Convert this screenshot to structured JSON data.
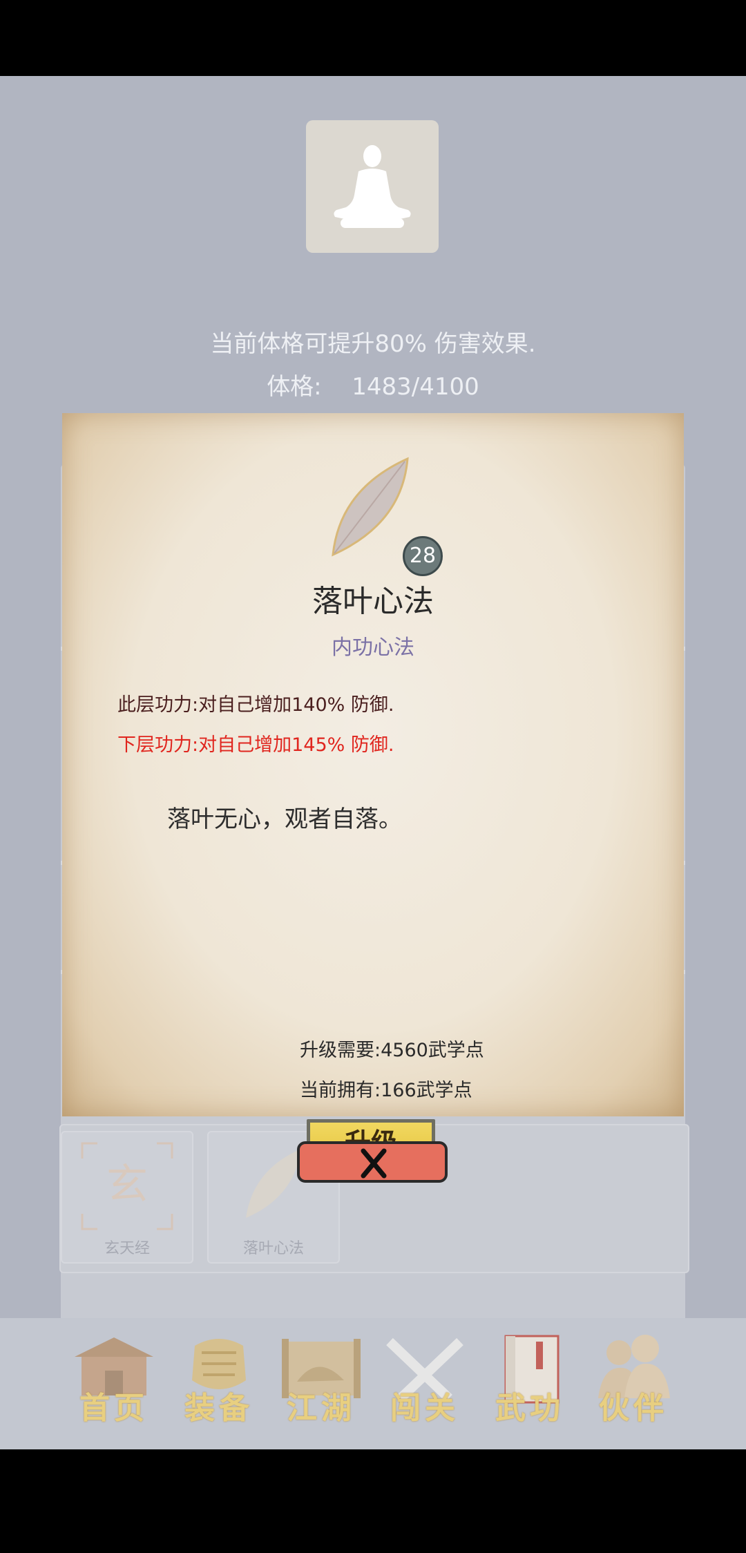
{
  "stats": {
    "bonus_text": "当前体格可提升80% 伤害效果.",
    "constitution_label": "体格:",
    "constitution_value": "1483/4100"
  },
  "skill": {
    "level": "28",
    "name": "落叶心法",
    "type": "内功心法",
    "current_effect": "此层功力:对自己增加140% 防御.",
    "next_effect": "下层功力:对自己增加145% 防御.",
    "quote": "落叶无心，观者自落。",
    "upgrade_cost": "升级需要:4560武学点",
    "current_points": "当前拥有:166武学点",
    "upgrade_label": "升级"
  },
  "skill_slots": [
    {
      "label": "玄天经",
      "icon": "xuan-seal-icon"
    },
    {
      "label": "落叶心法",
      "icon": "leaf-icon"
    }
  ],
  "nav": [
    {
      "label": "首页",
      "icon": "home-building-icon"
    },
    {
      "label": "装备",
      "icon": "armor-icon"
    },
    {
      "label": "江湖",
      "icon": "scroll-map-icon"
    },
    {
      "label": "闯关",
      "icon": "crossed-swords-icon"
    },
    {
      "label": "武功",
      "icon": "book-icon"
    },
    {
      "label": "伙伴",
      "icon": "companions-icon"
    }
  ],
  "colors": {
    "effect_current": "#4a1e1e",
    "effect_next": "#e0251e",
    "skill_type": "#7b71a6",
    "upgrade_button": "#e8ca4a",
    "close_button": "#e66f5e"
  }
}
